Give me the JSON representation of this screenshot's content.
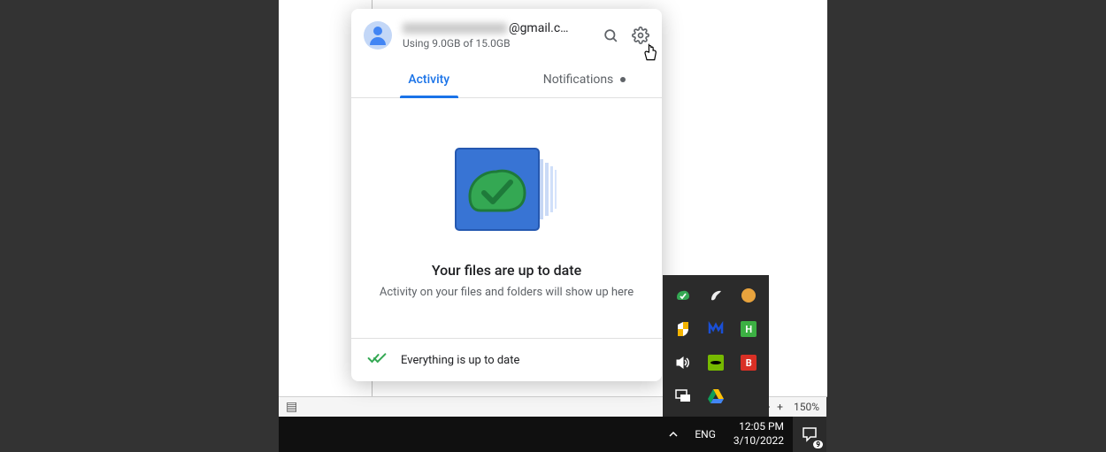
{
  "account": {
    "email_suffix": "@gmail.c…",
    "storage_text": "Using 9.0GB of 15.0GB"
  },
  "tabs": {
    "activity": "Activity",
    "notifications": "Notifications"
  },
  "activity": {
    "title": "Your files are up to date",
    "subtitle": "Activity on your files and folders will show up here"
  },
  "footer": {
    "status": "Everything is up to date"
  },
  "bottom_bar": {
    "zoom_level": "150%",
    "minus": "–",
    "plus": "+"
  },
  "taskbar": {
    "lang_label": "ENG",
    "time": "12:05 PM",
    "date": "3/10/2022",
    "notification_count": "9"
  },
  "tray_icons": {
    "r1c1": "backup-sync-icon",
    "r1c2": "razer-icon",
    "r1c3": "app-icon",
    "r2c1": "security-icon",
    "r2c2": "malwarebytes-icon",
    "r2c3": "hwinfo-icon",
    "r3c1": "volume-icon",
    "r3c2": "nvidia-icon",
    "r3c3": "b-tray-icon",
    "r4c1": "project-screen-icon",
    "r4c2": "google-drive-icon"
  }
}
